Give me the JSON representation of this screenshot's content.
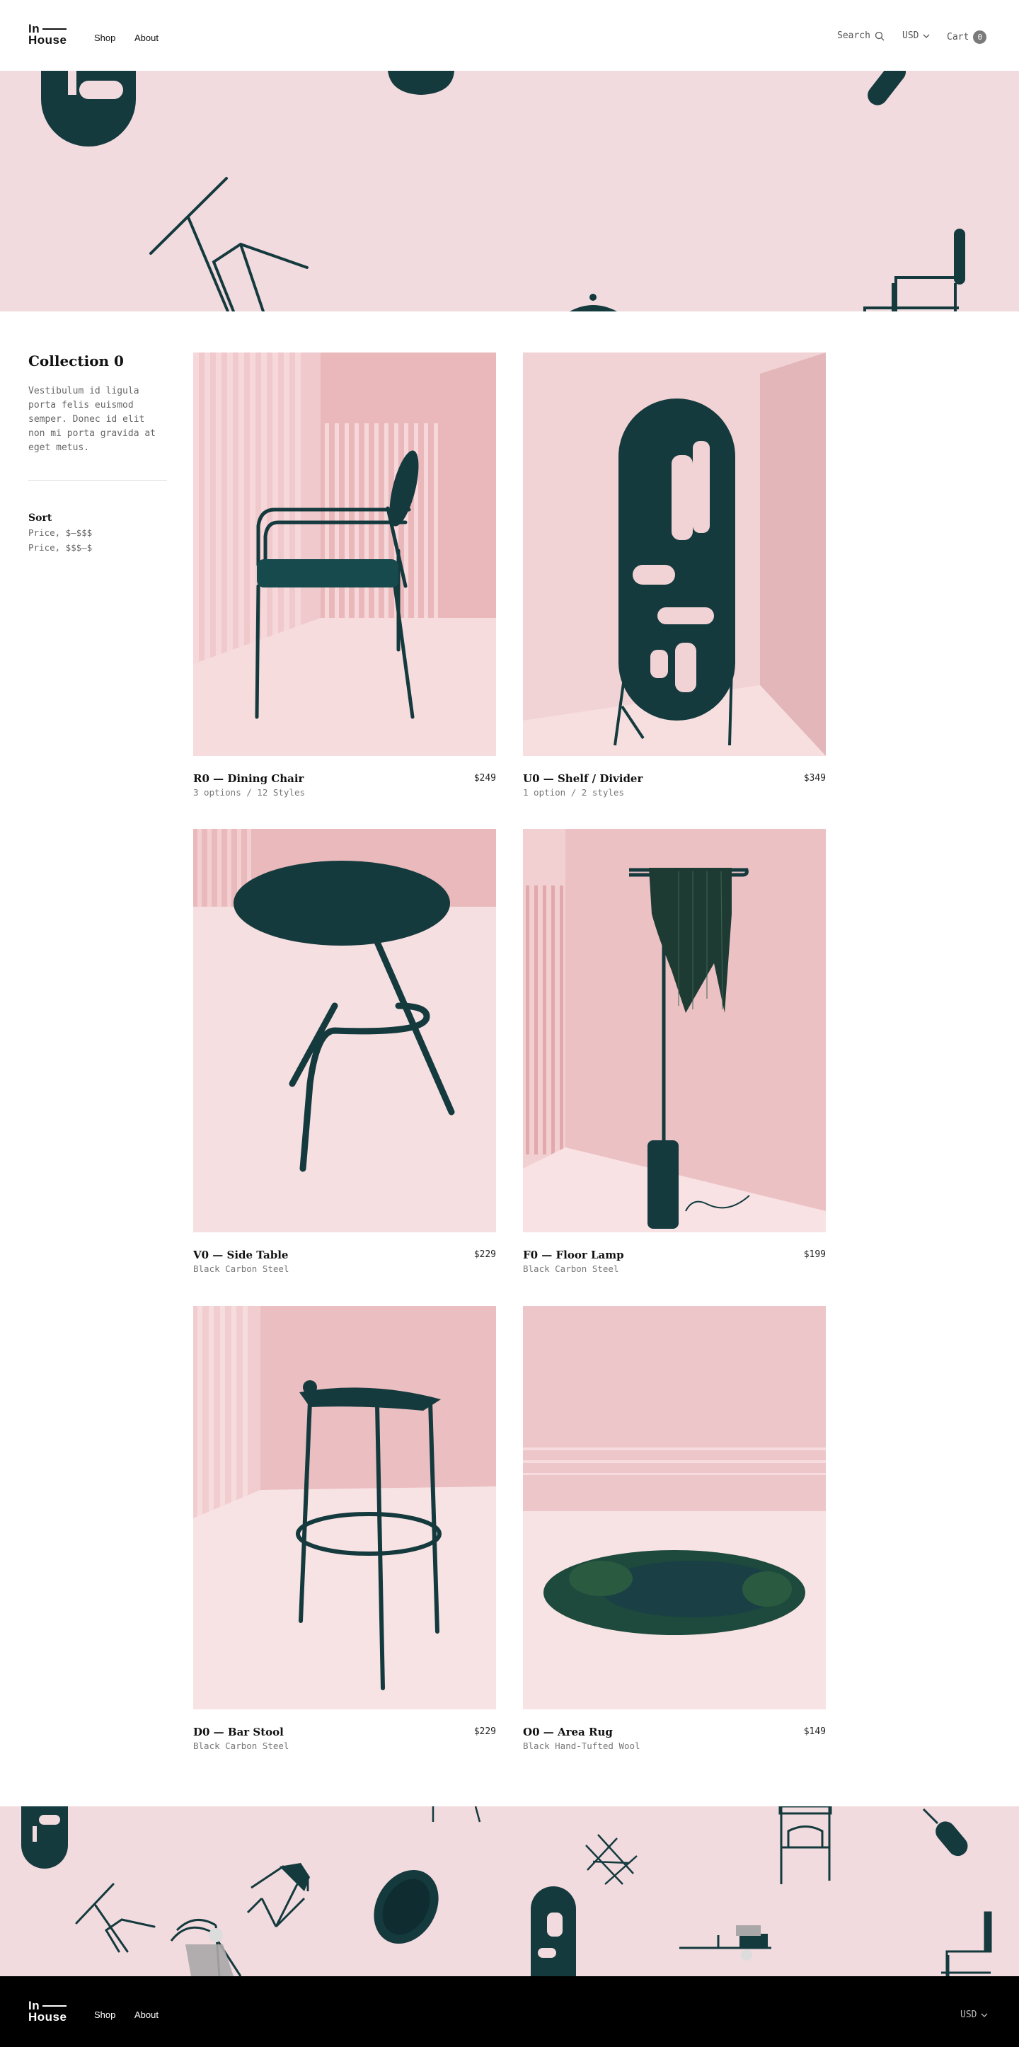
{
  "header": {
    "logo_line1": "In",
    "logo_line2": "House",
    "nav": {
      "shop": "Shop",
      "about": "About"
    },
    "search_label": "Search",
    "currency": "USD",
    "cart_label": "Cart",
    "cart_count": "0"
  },
  "collection": {
    "title": "Collection 0",
    "description": "Vestibulum id ligula porta felis euismod semper. Donec id elit non mi porta gravida at eget metus."
  },
  "sort": {
    "title": "Sort",
    "options": [
      "Price, $–$$$",
      "Price, $$$–$"
    ]
  },
  "products": [
    {
      "name": "R0 — Dining Chair",
      "subtitle": "3 options /  12 Styles",
      "price": "$249"
    },
    {
      "name": "U0 — Shelf / Divider",
      "subtitle": "1 option / 2 styles",
      "price": "$349"
    },
    {
      "name": "V0 — Side Table",
      "subtitle": "Black Carbon Steel",
      "price": "$229"
    },
    {
      "name": "F0 — Floor Lamp",
      "subtitle": "Black Carbon Steel",
      "price": "$199"
    },
    {
      "name": "D0 — Bar Stool",
      "subtitle": "Black Carbon Steel",
      "price": "$229"
    },
    {
      "name": "O0 — Area Rug",
      "subtitle": "Black Hand-Tufted Wool",
      "price": "$149"
    }
  ],
  "footer": {
    "logo_line1": "In",
    "logo_line2": "House",
    "nav": {
      "shop": "Shop",
      "about": "About"
    },
    "currency": "USD"
  },
  "colors": {
    "band_pink": "#f1dbde",
    "product_dark": "#143a3e",
    "footer_bg": "#000000"
  },
  "icons": [
    "search-icon",
    "chevron-down-icon",
    "cart-badge"
  ]
}
